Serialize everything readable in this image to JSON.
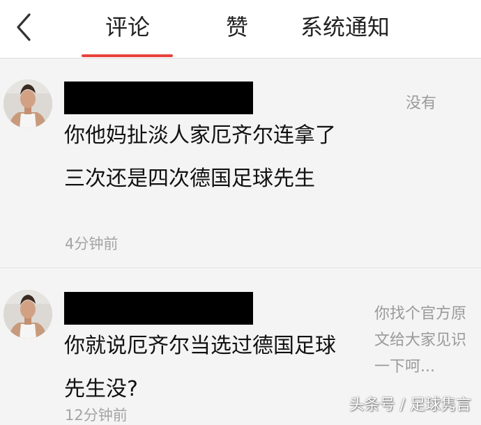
{
  "tabs": {
    "comments": "评论",
    "likes": "赞",
    "system": "系统通知"
  },
  "accent_color": "#e8413c",
  "comments": [
    {
      "text": "你他妈扯淡人家厄齐尔连拿了三次还是四次德国足球先生",
      "time": "4分钟前",
      "quote": "没有"
    },
    {
      "text": "你就说厄齐尔当选过德国足球先生没?",
      "time": "12分钟前",
      "quote": "你找个官方原文给大家见识一下呵..."
    }
  ],
  "watermark": "头条号 / 足球隽言"
}
